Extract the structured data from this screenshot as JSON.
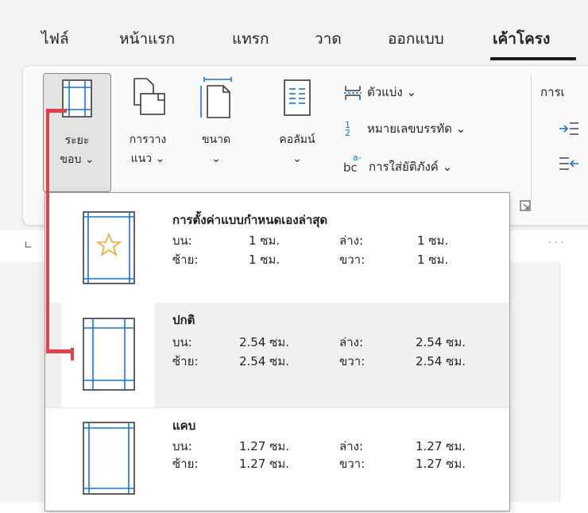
{
  "tabs": [
    {
      "label": "ไฟล์"
    },
    {
      "label": "หน้าแรก"
    },
    {
      "label": "แทรก"
    },
    {
      "label": "วาด"
    },
    {
      "label": "ออกแบบ"
    },
    {
      "label": "เค้าโครง"
    }
  ],
  "ribbon": {
    "margins": {
      "line1": "ระยะ",
      "line2": "ขอบ ⌄"
    },
    "orientation": {
      "line1": "การวาง",
      "line2": "แนว ⌄"
    },
    "size": {
      "line1": "ขนาด",
      "line2": "⌄"
    },
    "columns": {
      "line1": "คอลัมน์",
      "line2": "⌄"
    },
    "breaks": "ตัวแบ่ง ⌄",
    "line_numbers": "หมายเลขบรรทัด ⌄",
    "hyphenation": "การใส่ยัติภังค์ ⌄",
    "line_numbers_icon_text": "1\n2",
    "hyphen_icon_text": "bc",
    "hyphen_icon_sup": "a-",
    "indent_group_label": "การเ"
  },
  "margins_menu": {
    "options": [
      {
        "title": "การตั้งค่าแบบกำหนดเองล่าสุด",
        "top_label": "บน:",
        "top_value": "1 ซม.",
        "bottom_label": "ล่าง:",
        "bottom_value": "1 ซม.",
        "left_label": "ซ้าย:",
        "left_value": "1 ซม.",
        "right_label": "ขวา:",
        "right_value": "1 ซม."
      },
      {
        "title": "ปกติ",
        "top_label": "บน:",
        "top_value": "2.54 ซม.",
        "bottom_label": "ล่าง:",
        "bottom_value": "2.54 ซม.",
        "left_label": "ซ้าย:",
        "left_value": "2.54 ซม.",
        "right_label": "ขวา:",
        "right_value": "2.54 ซม."
      },
      {
        "title": "แคบ",
        "top_label": "บน:",
        "top_value": "1.27 ซม.",
        "bottom_label": "ล่าง:",
        "bottom_value": "1.27 ซม.",
        "left_label": "ซ้าย:",
        "left_value": "1.27 ซม.",
        "right_label": "ขวา:",
        "right_value": "1.27 ซม."
      }
    ]
  },
  "colors": {
    "accent_blue": "#1a73c9",
    "annotation_red": "#e0414a",
    "star": "#e8a53a"
  }
}
